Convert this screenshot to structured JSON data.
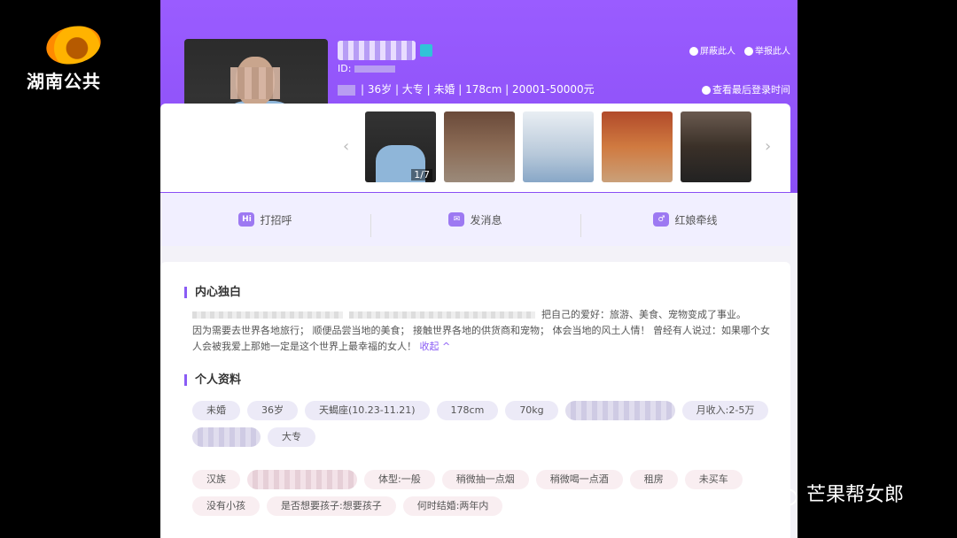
{
  "overlay": {
    "channel_logo_text": "湖南公共",
    "watermark_text": "芒果帮女郎"
  },
  "profile": {
    "id_label": "ID:",
    "info": "| 36岁 | 大专 | 未婚 | 178cm | 20001-50000元",
    "block_label": "屏蔽此人",
    "report_label": "举报此人",
    "last_login_label": "查看最后登录时间"
  },
  "gallery": {
    "counter": "1/7",
    "prev_icon": "chevron-left-icon",
    "next_icon": "chevron-right-icon"
  },
  "actions": [
    {
      "icon_text": "Hi",
      "label": "打招呼"
    },
    {
      "icon_text": "✉",
      "label": "发消息"
    },
    {
      "icon_text": "♂",
      "label": "红娘牵线"
    }
  ],
  "about": {
    "title": "内心独白",
    "text_part1": "把自己的爱好：旅游、美食、宠物变成了事业。",
    "text_part2": "因为需要去世界各地旅行； 顺便品尝当地的美食； 接触世界各地的供货商和宠物； 体会当地的风土人情！ 曾经有人说过：如果哪个女人会被我爱上那她一定是这个世界上最幸福的女人！",
    "collapse_label": "收起 ^"
  },
  "personal": {
    "title": "个人资料",
    "tags_row1": [
      "未婚",
      "36岁",
      "天蝎座(10.23-11.21)",
      "178cm",
      "70kg",
      "",
      "月收入:2-5万",
      "",
      "大专"
    ],
    "tags_row2": [
      "汉族",
      "",
      "体型:一般",
      "稍微抽一点烟",
      "稍微喝一点酒",
      "租房",
      "未买车",
      "没有小孩",
      "是否想要孩子:想要孩子",
      "何时结婚:两年内"
    ]
  },
  "colors": {
    "header_purple": "#9a5cff",
    "accent": "#8a5cf5"
  }
}
